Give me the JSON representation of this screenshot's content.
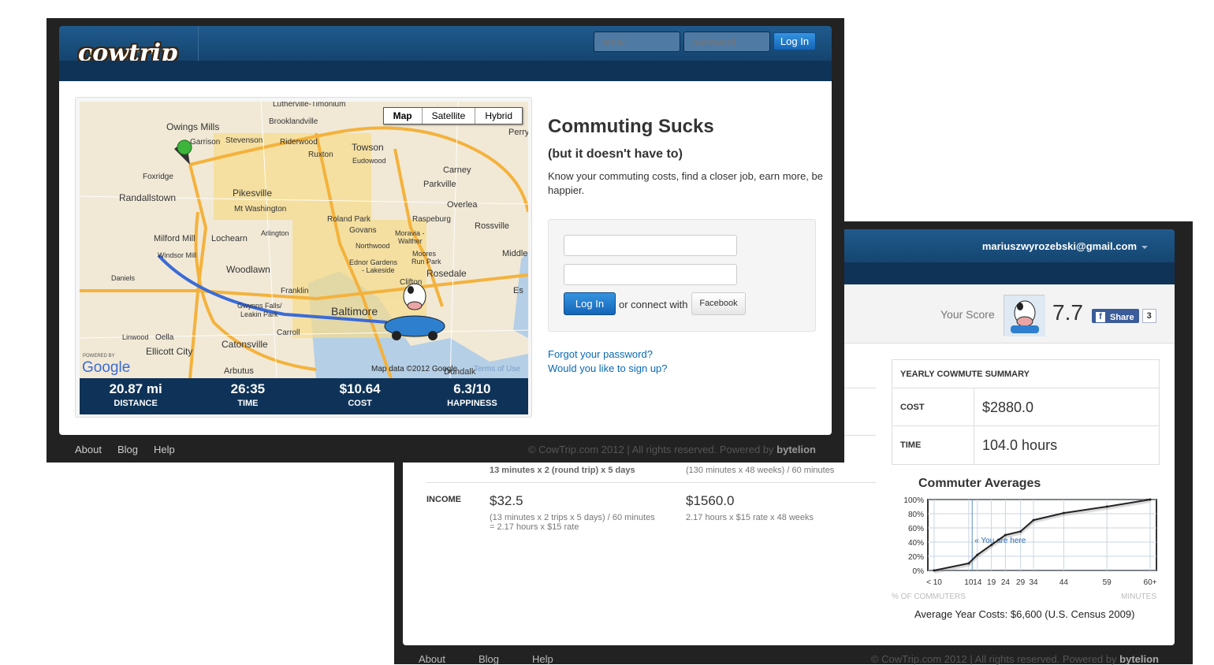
{
  "back": {
    "user_email": "mariuszwyrozebski@gmail.com",
    "score_label": "Your Score",
    "score_value": "7.7",
    "share_label": "Share",
    "share_count": "3",
    "time_daily_detail": "13 minutes x 2 (round trip) x 5 days",
    "time_yearly_detail": "(130 minutes x 48 weeks) / 60 minutes",
    "income_label": "INCOME",
    "income_daily": "$32.5",
    "income_daily_detail_1": "(13 minutes x 2 trips x 5 days) / 60 minutes",
    "income_daily_detail_2": "= 2.17 hours x $15 rate",
    "income_yearly": "$1560.0",
    "income_yearly_detail": "2.17 hours x $15 rate x 48 weeks",
    "summary_title": "YEARLY COWMUTE SUMMARY",
    "summary_rows": [
      {
        "k": "COST",
        "v": "$2880.0"
      },
      {
        "k": "TIME",
        "v": "104.0 hours"
      }
    ],
    "averages_title": "Commuter Averages",
    "census_note": "Average Year Costs: $6,600 (U.S. Census 2009)",
    "footer_links": [
      "About",
      "Blog",
      "Help"
    ],
    "footer_copy": "© CowTrip.com 2012 | All rights reserved. Powered by",
    "footer_brand": "bytelion"
  },
  "chart_data": {
    "type": "line",
    "x_ticks": [
      "< 10",
      "10",
      "14",
      "19",
      "24",
      "29",
      "34",
      "44",
      "59",
      "60+"
    ],
    "y_ticks": [
      "0%",
      "20%",
      "40%",
      "60%",
      "80%",
      "100%"
    ],
    "values": [
      0,
      10,
      22,
      36,
      50,
      55,
      71,
      81,
      90,
      100
    ],
    "ylim": [
      0,
      100
    ],
    "xlabel_left": "% OF COMMUTERS",
    "xlabel_right": "MINUTES",
    "marker_label": "« You are here",
    "marker_index": 1.4,
    "grid": true
  },
  "front": {
    "logo": "cowtrip",
    "email_placeholder": "email",
    "password_placeholder": "password",
    "login_label": "Log In",
    "map_types": [
      "Map",
      "Satellite",
      "Hybrid"
    ],
    "map_attribution": "Map data ©2012 Google",
    "map_terms": "Terms of Use",
    "map_powered": "POWERED BY",
    "map_places": [
      "Lutherville-Timonium",
      "Owings Mills",
      "Garrison",
      "Stevenson",
      "Brooklandville",
      "Riderwood",
      "Towson",
      "Eudowood",
      "Perry",
      "Carney",
      "Parkville",
      "Overlea",
      "Rossville",
      "Foxridge",
      "Ruxton",
      "Randallstown",
      "Pikesville",
      "Mt Washington",
      "Roland Park",
      "Raspeburg",
      "Govans",
      "Moravia - Walther",
      "Milford Mill",
      "Lochearn",
      "Arlington",
      "Northwood",
      "Moores Run Park",
      "Windsor Mill",
      "Ednor Gardens - Lakeside",
      "Rosedale",
      "Middle",
      "Daniels",
      "Woodlawn",
      "Franklin",
      "Clifton",
      "Gwynns Falls/ Leakin Park",
      "Baltimore",
      "Linwood",
      "Oella",
      "Carroll",
      "Ellicott City",
      "Catonsville",
      "Dundalk",
      "Arbutus",
      "Es"
    ],
    "stats": [
      {
        "n": "20.87 mi",
        "l": "DISTANCE"
      },
      {
        "n": "26:35",
        "l": "TIME"
      },
      {
        "n": "$10.64",
        "l": "COST"
      },
      {
        "n": "6.3/10",
        "l": "HAPPINESS"
      }
    ],
    "headline": "Commuting Sucks",
    "subhead": "(but it doesn't have to)",
    "pitch": "Know your commuting costs, find a closer job, earn more, be happier.",
    "login_button": "Log In",
    "or_connect": "or connect with",
    "facebook": "Facebook",
    "forgot": "Forgot your password?",
    "signup": "Would you like to sign up?",
    "footer_links": [
      "About",
      "Blog",
      "Help"
    ],
    "footer_copy": "© CowTrip.com 2012 | All rights reserved. Powered by",
    "footer_brand": "bytelion"
  },
  "colors": {
    "brand_blue": "#164772",
    "link": "#0769b6",
    "stats_bar": "#0f3358"
  }
}
